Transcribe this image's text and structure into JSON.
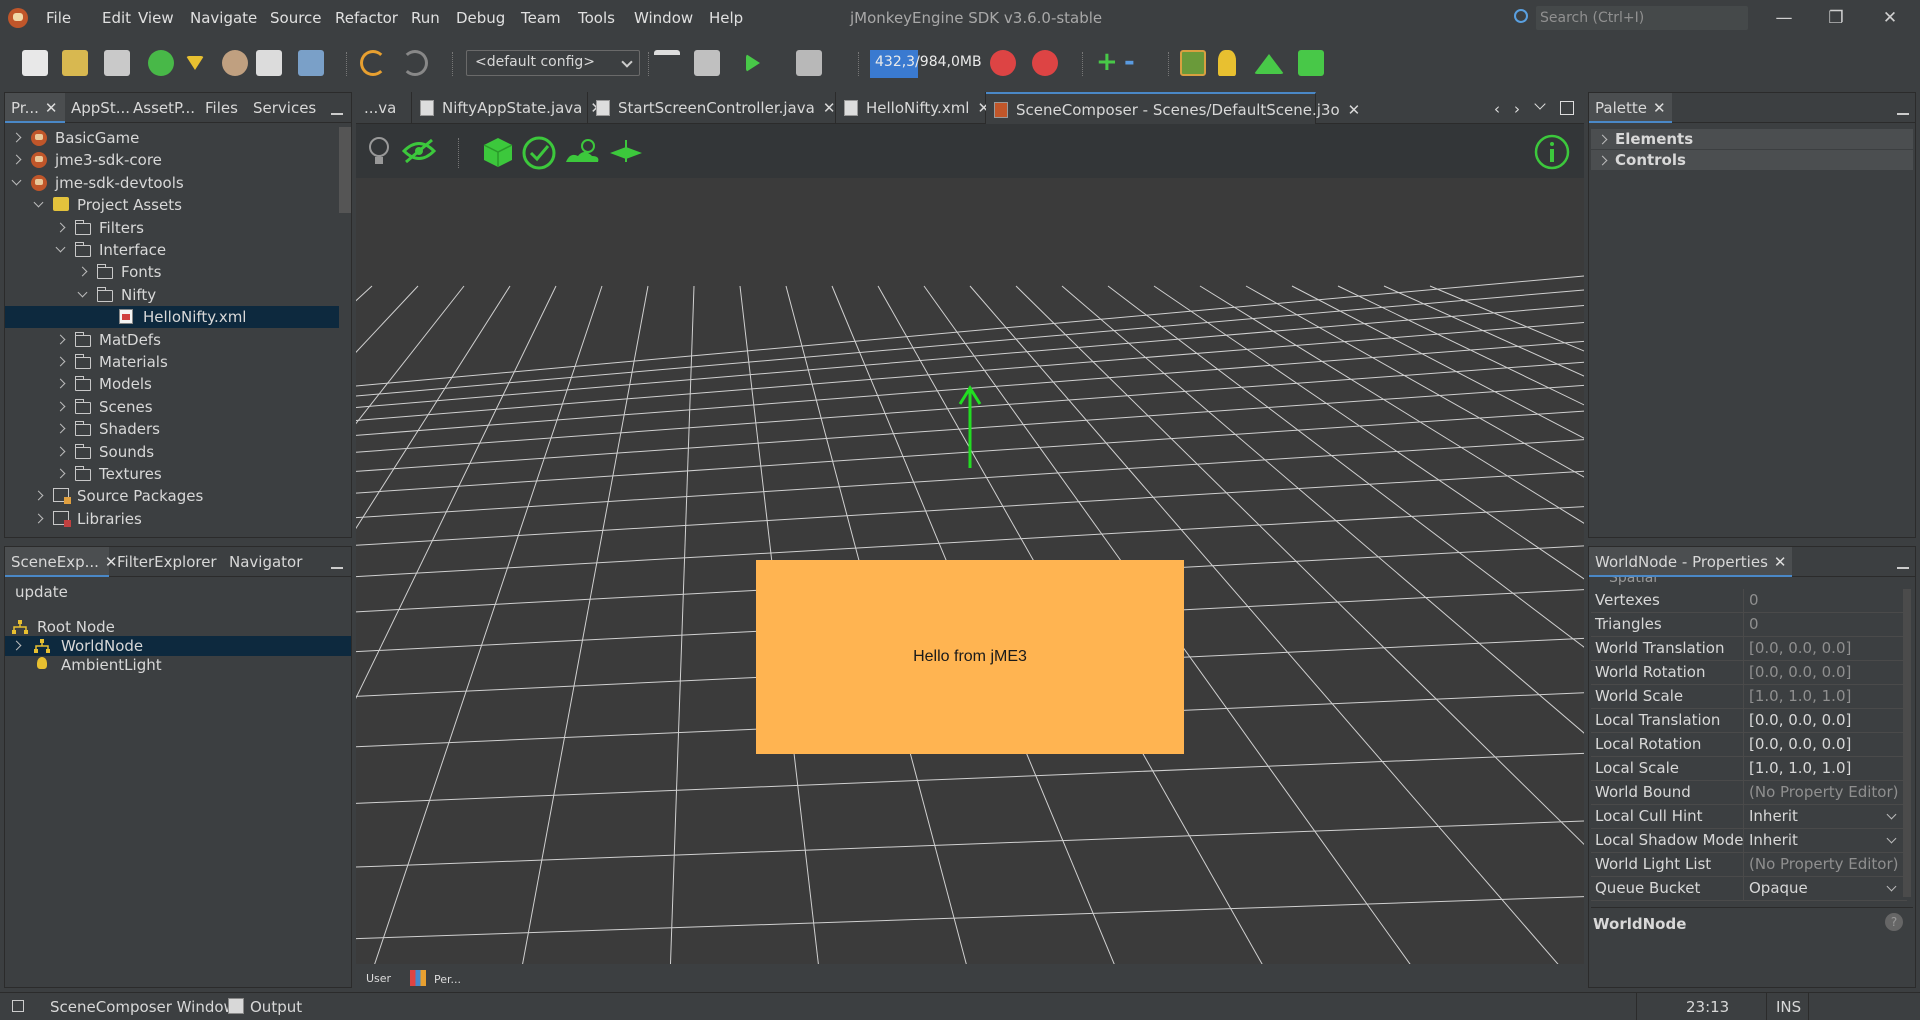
{
  "window": {
    "title": "jMonkeyEngine SDK v3.6.0-stable",
    "search_placeholder": "Search (Ctrl+I)"
  },
  "menu": [
    "File",
    "Edit",
    "View",
    "Navigate",
    "Source",
    "Refactor",
    "Run",
    "Debug",
    "Team",
    "Tools",
    "Window",
    "Help"
  ],
  "toolbar": {
    "config_value": "<default config>",
    "memory_text": "432,3/984,0MB",
    "memory_fraction": 0.44,
    "icons": [
      "new-file-icon",
      "new-project-icon",
      "open-project-icon",
      "download-icon",
      "filter-icon",
      "tools-icon",
      "save-icon",
      "save-all-icon",
      "undo-icon",
      "redo-icon",
      "build-icon",
      "clean-build-icon",
      "run-icon",
      "profile-icon",
      "gc-icon",
      "gc-alt-icon",
      "plus-icon",
      "minus-icon",
      "image-icon",
      "torch-icon",
      "terrain-icon",
      "vehicle-icon"
    ]
  },
  "projects_panel": {
    "tabs": [
      "Pr...",
      "AppSt...",
      "AssetP...",
      "Files",
      "Services"
    ],
    "tree": [
      {
        "label": "BasicGame",
        "depth": 0,
        "icon": "project",
        "state": "collapsed"
      },
      {
        "label": "jme3-sdk-core",
        "depth": 0,
        "icon": "project",
        "state": "collapsed"
      },
      {
        "label": "jme-sdk-devtools",
        "depth": 0,
        "icon": "project",
        "state": "expanded"
      },
      {
        "label": "Project Assets",
        "depth": 1,
        "icon": "assets",
        "state": "expanded"
      },
      {
        "label": "Filters",
        "depth": 2,
        "icon": "folder",
        "state": "collapsed"
      },
      {
        "label": "Interface",
        "depth": 2,
        "icon": "folder",
        "state": "expanded"
      },
      {
        "label": "Fonts",
        "depth": 3,
        "icon": "folder",
        "state": "collapsed"
      },
      {
        "label": "Nifty",
        "depth": 3,
        "icon": "folder",
        "state": "expanded"
      },
      {
        "label": "HelloNifty.xml",
        "depth": 4,
        "icon": "xml",
        "state": "leaf",
        "selected": true
      },
      {
        "label": "MatDefs",
        "depth": 2,
        "icon": "folder",
        "state": "collapsed"
      },
      {
        "label": "Materials",
        "depth": 2,
        "icon": "folder",
        "state": "collapsed"
      },
      {
        "label": "Models",
        "depth": 2,
        "icon": "folder",
        "state": "collapsed"
      },
      {
        "label": "Scenes",
        "depth": 2,
        "icon": "folder",
        "state": "collapsed"
      },
      {
        "label": "Shaders",
        "depth": 2,
        "icon": "folder",
        "state": "collapsed"
      },
      {
        "label": "Sounds",
        "depth": 2,
        "icon": "folder",
        "state": "collapsed"
      },
      {
        "label": "Textures",
        "depth": 2,
        "icon": "folder",
        "state": "collapsed"
      },
      {
        "label": "Source Packages",
        "depth": 1,
        "icon": "package",
        "state": "collapsed"
      },
      {
        "label": "Libraries",
        "depth": 1,
        "icon": "library",
        "state": "collapsed"
      }
    ]
  },
  "scene_panel": {
    "tabs": [
      "SceneExp...",
      "FilterExplorer",
      "Navigator"
    ],
    "update_label": "update",
    "tree": [
      {
        "label": "Root Node",
        "depth": 0,
        "icon": "node",
        "state": "leaf"
      },
      {
        "label": "WorldNode",
        "depth": 0,
        "icon": "node",
        "state": "collapsed",
        "selected": true
      },
      {
        "label": "AmbientLight",
        "depth": 0,
        "icon": "light",
        "state": "leaf"
      }
    ]
  },
  "editor": {
    "tabs": [
      {
        "label": "...va",
        "closable": false
      },
      {
        "label": "NiftyAppState.java",
        "closable": true
      },
      {
        "label": "StartScreenController.java",
        "closable": true
      },
      {
        "label": "HelloNifty.xml",
        "closable": true
      },
      {
        "label": "SceneComposer - Scenes/DefaultScene.j3o",
        "closable": true,
        "active": true
      }
    ],
    "scene_text": "Hello from jME3",
    "footer_user": "User",
    "footer_per": "Per..."
  },
  "palette": {
    "tab": "Palette",
    "items": [
      "Elements",
      "Controls"
    ]
  },
  "properties": {
    "tab": "WorldNode - Properties",
    "section": "Spatial",
    "rows": [
      {
        "name": "Vertexes",
        "value": "0",
        "editable": false
      },
      {
        "name": "Triangles",
        "value": "0",
        "editable": false
      },
      {
        "name": "World Translation",
        "value": "[0.0, 0.0, 0.0]",
        "editable": false
      },
      {
        "name": "World Rotation",
        "value": "[0.0, 0.0, 0.0]",
        "editable": false
      },
      {
        "name": "World Scale",
        "value": "[1.0, 1.0, 1.0]",
        "editable": false
      },
      {
        "name": "Local Translation",
        "value": "[0.0, 0.0, 0.0]",
        "editable": true
      },
      {
        "name": "Local Rotation",
        "value": "[0.0, 0.0, 0.0]",
        "editable": true
      },
      {
        "name": "Local Scale",
        "value": "[1.0, 1.0, 1.0]",
        "editable": true
      },
      {
        "name": "World Bound",
        "value": "(No Property Editor)",
        "editable": false
      },
      {
        "name": "Local Cull Hint",
        "value": "Inherit",
        "editable": true,
        "dropdown": true
      },
      {
        "name": "Local Shadow Mode",
        "value": "Inherit",
        "editable": true,
        "dropdown": true
      },
      {
        "name": "World Light List",
        "value": "(No Property Editor)",
        "editable": false
      },
      {
        "name": "Queue Bucket",
        "value": "Opaque",
        "editable": true,
        "dropdown": true
      }
    ],
    "description_title": "WorldNode"
  },
  "statusbar": {
    "window_label": "SceneComposer Window",
    "output_label": "Output",
    "position": "23:13",
    "mode": "INS"
  },
  "colors": {
    "accent": "#4a88c7",
    "selection": "#0d293e",
    "scene_box": "#ffb451",
    "gizmo": "#22dd22"
  }
}
